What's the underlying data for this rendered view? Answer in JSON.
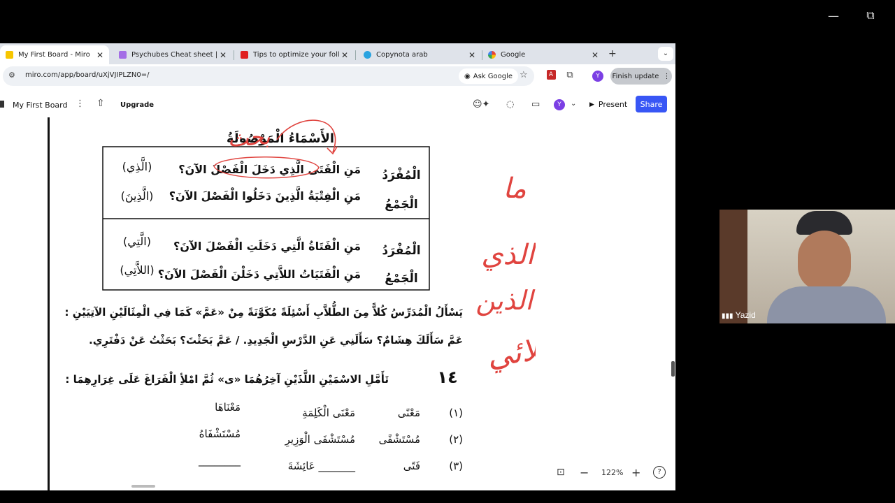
{
  "window_controls": {
    "minimize": "—",
    "restore": "⧉"
  },
  "tabs": [
    {
      "title": "My First Board - Miro",
      "favicon_color": "#f7c600",
      "active": true
    },
    {
      "title": "Psychubes Cheat sheet | Rev",
      "favicon_color": "#a46ee6",
      "active": false
    },
    {
      "title": "Tips to optimize your follow-",
      "favicon_color": "#e02020",
      "active": false
    },
    {
      "title": "Copynota arab",
      "favicon_color": "#2aa3e0",
      "active": false
    },
    {
      "title": "Google",
      "favicon_color": "#4285f4",
      "active": false
    }
  ],
  "address": {
    "url": "miro.com/app/board/uXjVJIPLZN0=/",
    "ask_google": "Ask Google",
    "profile": "Y",
    "finish_update": "Finish update"
  },
  "miro": {
    "board_name": "My First Board",
    "upgrade": "Upgrade",
    "avatar": "Y",
    "present": "Present",
    "share": "Share",
    "zoom": "122%"
  },
  "worksheet": {
    "title": "الأَسْمَاءُ الْمَوْصُولَةُ",
    "rows": [
      {
        "label": "الْمُفْرَدُ",
        "sentence": "مَنِ الْفَتَى الَّذِي دَخَلَ الْفَصْلَ الآنَ؟",
        "pronoun": "(الَّذِي)"
      },
      {
        "label": "الْجَمْعُ",
        "sentence": "مَنِ الْفِتْيَةُ الَّذِينَ دَخَلُوا الْفَصْلَ الآنَ؟",
        "pronoun": "(الَّذِينَ)"
      },
      {
        "label": "الْمُفْرَدُ",
        "sentence": "مَنِ الْفَتَاةُ الَّتِي دَخَلَتِ الْفَصْلَ الآنَ؟",
        "pronoun": "(الَّتِي)"
      },
      {
        "label": "الْجَمْعُ",
        "sentence": "مَنِ الْفَتَيَاتُ اللاَّتِي دَخَلْنَ الْفَصْلَ الآنَ؟",
        "pronoun": "(اللاَّتِي)"
      }
    ],
    "para1": "يَسْأَلُ الْمُدَرِّسُ كُلاًّ مِنَ الطُّلاَّبِ أَسْئِلَةً مُكَوَّنَةً مِنْ «عَمَّ» كَمَا فِي الْمِثَالَيْنِ الآتِيَيْنِ :",
    "para2": "عَمَّ سَأَلَكَ هِشَامٌ؟ سَأَلَنِي عَنِ الدَّرْسِ الْجَدِيدِ. / عَمَّ بَحَثْتَ؟ بَحَثْتُ عَنْ دَفْتَرِي.",
    "exercise_number": "١٤",
    "exercise_text": "تَأَمَّلِ الاسْمَيْنِ اللَّذَيْنِ آخِرُهُمَا «ى» ثُمَّ امْلأِ الْفَرَاغَ عَلَى غِرَارِهِمَا :",
    "table": [
      {
        "num": "(١)",
        "word": "مَعْنًى",
        "meaning": "مَعْنَى الْكَلِمَةِ",
        "answer": "مَعْنَاهَا"
      },
      {
        "num": "(٢)",
        "word": "مُسْتَشْفًى",
        "meaning": "مُسْتَشْفَى الْوَزِيرِ",
        "answer": "مُسْتَشْفَاهُ"
      },
      {
        "num": "(٣)",
        "word": "فَتًى",
        "meaning": "_______ عَائِشَةَ",
        "answer": "________"
      }
    ],
    "handwriting": [
      "بحث",
      "ما",
      "الذي",
      "الذين",
      "اللائي"
    ]
  },
  "webcam": {
    "name": "Yazid"
  },
  "colors": {
    "accent": "#3856f5",
    "ink_red": "#e0443f"
  }
}
